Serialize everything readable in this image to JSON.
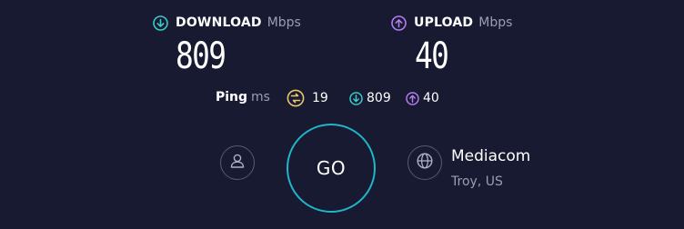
{
  "colors": {
    "background": "#171a30",
    "download_accent": "#3cc8c8",
    "upload_accent": "#b57cf0",
    "ping_accent": "#e9c86d",
    "go_ring": "#21b5c9",
    "muted_text": "#9b9db5"
  },
  "download": {
    "icon": "download-arrow-icon",
    "label": "DOWNLOAD",
    "unit": "Mbps",
    "value": "809"
  },
  "upload": {
    "icon": "upload-arrow-icon",
    "label": "UPLOAD",
    "unit": "Mbps",
    "value": "40"
  },
  "ping": {
    "label": "Ping",
    "unit": "ms",
    "idle_icon": "ping-idle-icon",
    "idle_value": "19",
    "download_value": "809",
    "upload_value": "40"
  },
  "go_button": {
    "label": "GO"
  },
  "user_button": {
    "icon": "user-icon"
  },
  "server": {
    "icon": "globe-icon",
    "isp": "Mediacom",
    "location": "Troy, US"
  }
}
